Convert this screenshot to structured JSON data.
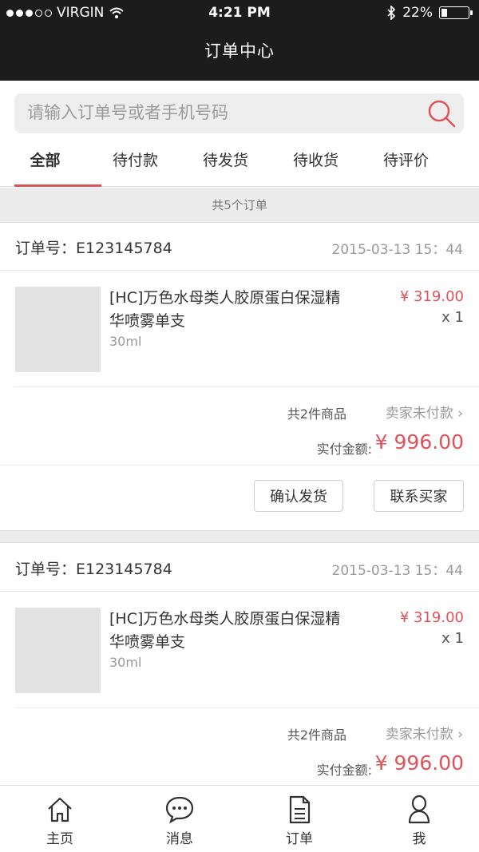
{
  "status_bar": {
    "carrier": "VIRGIN",
    "time": "4:21 PM",
    "battery": "22%",
    "battery_fraction": 0.22
  },
  "header": {
    "title": "订单中心"
  },
  "search": {
    "placeholder": "请输入订单号或者手机号码"
  },
  "tabs": [
    {
      "label": "全部",
      "active": true
    },
    {
      "label": "待付款",
      "active": false
    },
    {
      "label": "待发货",
      "active": false
    },
    {
      "label": "待收货",
      "active": false
    },
    {
      "label": "待评价",
      "active": false
    }
  ],
  "order_count_text": "共5个订单",
  "orders": [
    {
      "order_no": "订单号：E123145784",
      "date": "2015-03-13  15：44",
      "product_name": "[HC]万色水母类人胶原蛋白保湿精华喷雾单支",
      "spec": "30ml",
      "price": "¥ 319.00",
      "qty": "x 1",
      "items_count": "共2件商品",
      "pay_status": "卖家未付款",
      "paid_label": "实付金额:",
      "paid_amount": "¥ 996.00",
      "actions": {
        "confirm": "确认发货",
        "contact": "联系买家"
      }
    },
    {
      "order_no": "订单号：E123145784",
      "date": "2015-03-13  15：44",
      "product_name": "[HC]万色水母类人胶原蛋白保湿精华喷雾单支",
      "spec": "30ml",
      "price": "¥ 319.00",
      "qty": "x 1",
      "items_count": "共2件商品",
      "pay_status": "卖家未付款",
      "paid_label": "实付金额:",
      "paid_amount": "¥ 996.00"
    }
  ],
  "bottom_nav": [
    {
      "label": "主页",
      "icon": "home-icon"
    },
    {
      "label": "消息",
      "icon": "message-icon"
    },
    {
      "label": "订单",
      "icon": "order-icon"
    },
    {
      "label": "我",
      "icon": "profile-icon"
    }
  ],
  "colors": {
    "accent": "#e0525a",
    "header_bg": "#1c1c1c"
  }
}
